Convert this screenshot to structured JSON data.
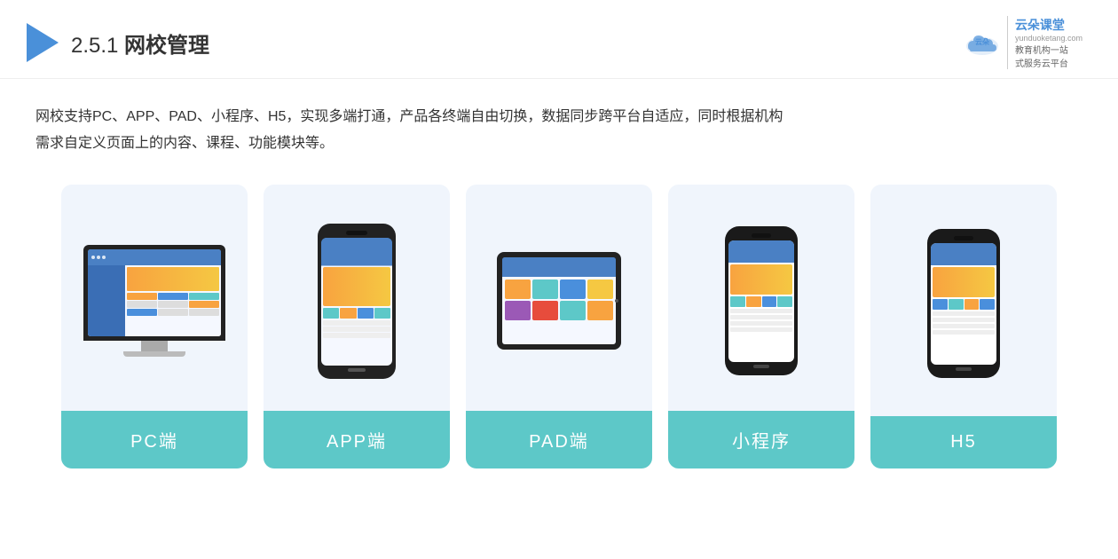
{
  "header": {
    "title_prefix": "2.5.1 ",
    "title_bold": "网校管理",
    "logo_main": "云朵课堂",
    "logo_url": "yunduoketang.com",
    "logo_tagline_line1": "教育机构一站",
    "logo_tagline_line2": "式服务云平台"
  },
  "description": {
    "text_line1": "网校支持PC、APP、PAD、小程序、H5，实现多端打通，产品各终端自由切换，数据同步跨平台自适应，同时根据机构",
    "text_line2": "需求自定义页面上的内容、课程、功能模块等。"
  },
  "cards": [
    {
      "id": "pc",
      "label": "PC端"
    },
    {
      "id": "app",
      "label": "APP端"
    },
    {
      "id": "pad",
      "label": "PAD端"
    },
    {
      "id": "miniapp",
      "label": "小程序"
    },
    {
      "id": "h5",
      "label": "H5"
    }
  ]
}
